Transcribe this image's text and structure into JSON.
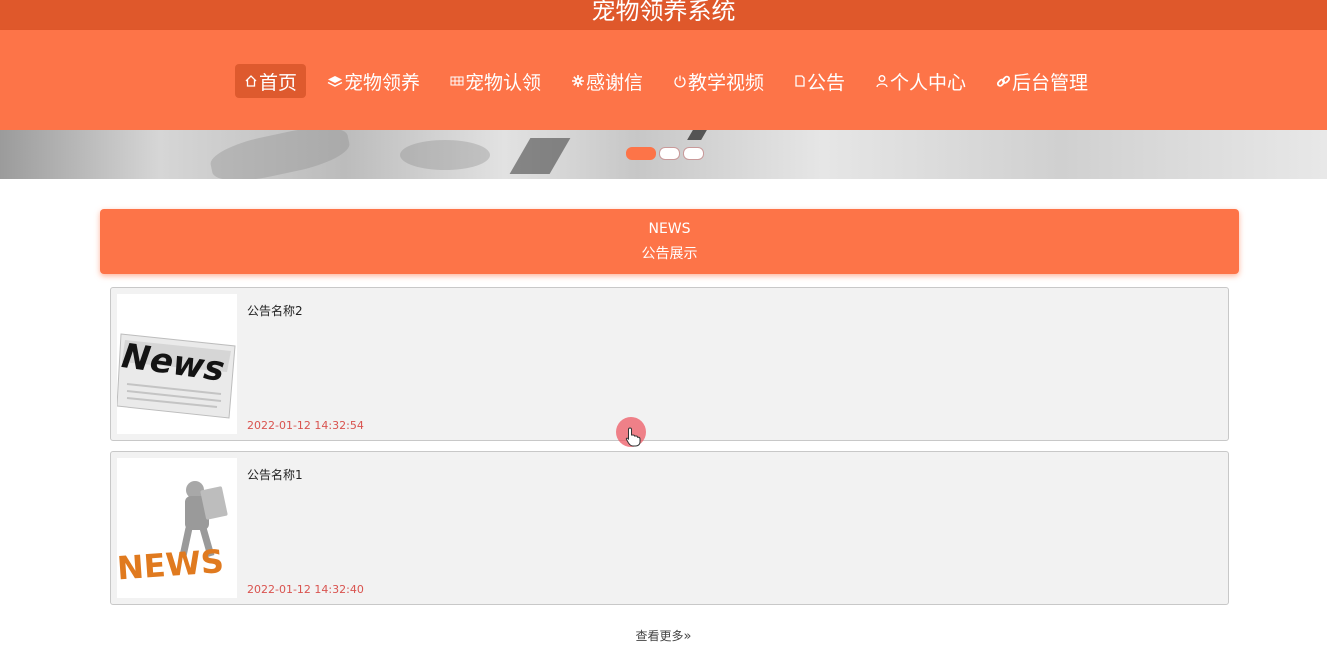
{
  "app": {
    "title": "宠物领养系统"
  },
  "nav": {
    "items": [
      {
        "label": "首页",
        "icon": "home-icon",
        "active": true
      },
      {
        "label": "宠物领养",
        "icon": "layers-icon"
      },
      {
        "label": "宠物认领",
        "icon": "grid-icon"
      },
      {
        "label": "感谢信",
        "icon": "gear-icon"
      },
      {
        "label": "教学视频",
        "icon": "power-icon"
      },
      {
        "label": "公告",
        "icon": "file-icon"
      },
      {
        "label": "个人中心",
        "icon": "user-icon"
      },
      {
        "label": "后台管理",
        "icon": "link-icon"
      }
    ]
  },
  "banner": {
    "slide_count": 3,
    "active_index": 0
  },
  "news": {
    "heading_en": "NEWS",
    "heading_cn": "公告展示",
    "items": [
      {
        "title": "公告名称2",
        "time": "2022-01-12 14:32:54",
        "thumb_text": "News",
        "thumb_icon": "newspaper-icon"
      },
      {
        "title": "公告名称1",
        "time": "2022-01-12 14:32:40",
        "thumb_text": "NEWS",
        "thumb_icon": "news-figure-icon"
      }
    ],
    "more_label": "查看更多",
    "more_icon": "double-chevron-right-icon"
  },
  "colors": {
    "primary": "#fd7448",
    "title_bar": "#df582b",
    "active_nav": "#de5a2e",
    "time_text": "#d9534f"
  }
}
